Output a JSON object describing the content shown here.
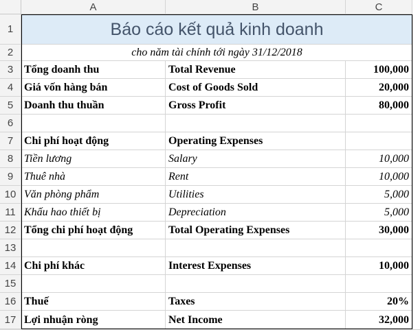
{
  "columns": [
    "A",
    "B",
    "C"
  ],
  "row_numbers": [
    "1",
    "2",
    "3",
    "4",
    "5",
    "6",
    "7",
    "8",
    "9",
    "10",
    "11",
    "12",
    "13",
    "14",
    "15",
    "16",
    "17"
  ],
  "title": "Báo cáo kết quả kinh doanh",
  "subtitle": "cho năm tài chính tới ngày 31/12/2018",
  "rows": [
    {
      "a": "Tổng doanh thu",
      "b": "Total Revenue",
      "c": "100,000"
    },
    {
      "a": "Giá vốn hàng bán",
      "b": "Cost of Goods Sold",
      "c": "20,000"
    },
    {
      "a": "Doanh thu thuần",
      "b": "Gross Profit",
      "c": "80,000"
    },
    {
      "a": "",
      "b": "",
      "c": ""
    },
    {
      "a": "Chi phí hoạt động",
      "b": "Operating Expenses",
      "c": ""
    },
    {
      "a": "Tiền lương",
      "b": "Salary",
      "c": "10,000"
    },
    {
      "a": "Thuê nhà",
      "b": "Rent",
      "c": "10,000"
    },
    {
      "a": "Văn phòng phẩm",
      "b": "Utilities",
      "c": "5,000"
    },
    {
      "a": "Khấu hao thiết bị",
      "b": "Depreciation",
      "c": "5,000"
    },
    {
      "a": "Tổng chi phí hoạt động",
      "b": "Total Operating Expenses",
      "c": "30,000"
    },
    {
      "a": "",
      "b": "",
      "c": ""
    },
    {
      "a": "Chi phí khác",
      "b": "Interest Expenses",
      "c": "10,000"
    },
    {
      "a": "",
      "b": "",
      "c": ""
    },
    {
      "a": "Thuế",
      "b": "Taxes",
      "c": "20%"
    },
    {
      "a": "Lợi nhuận ròng",
      "b": "Net Income",
      "c": "32,000"
    }
  ],
  "colors": {
    "title_fill": "#ddebf7",
    "title_text": "#44546a",
    "header_fill": "#f3f3f3",
    "gridline": "#d4d4d4"
  }
}
